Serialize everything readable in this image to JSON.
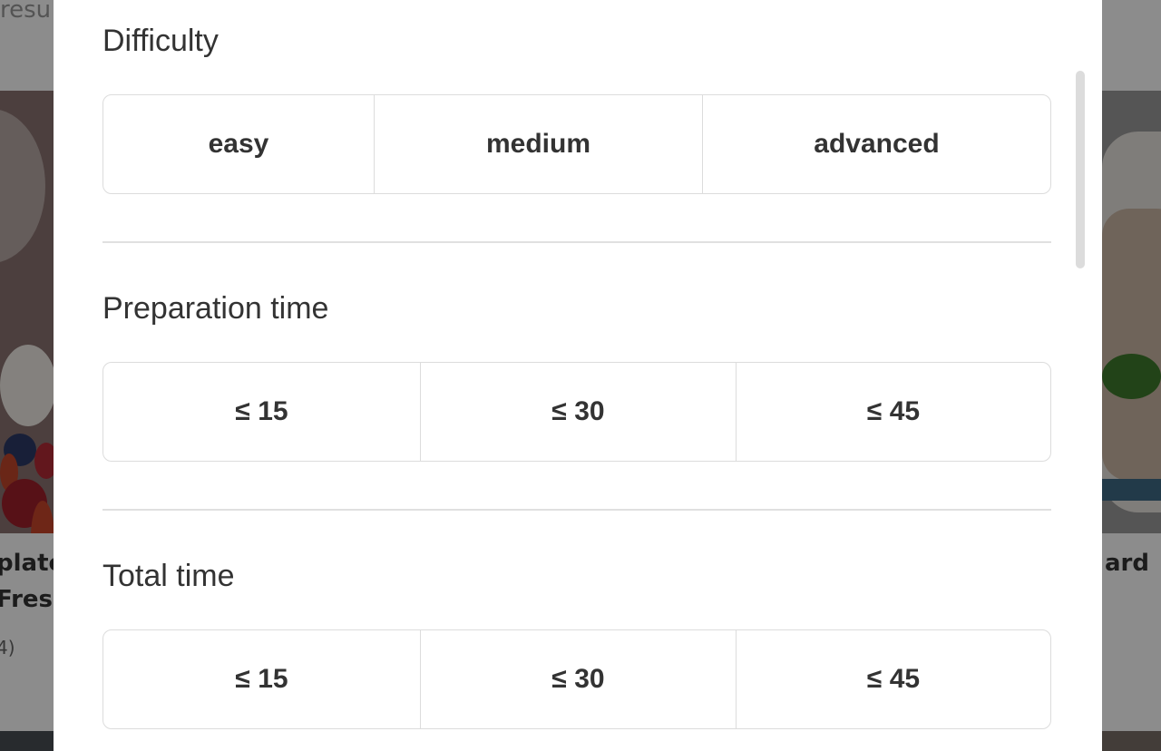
{
  "background": {
    "left_header_partial": "resu",
    "left_card": {
      "title_line1": "plate",
      "title_line2": "Fresh",
      "meta": "4)"
    },
    "right_card": {
      "title_line1": "ard"
    }
  },
  "filters": {
    "difficulty": {
      "title": "Difficulty",
      "options": [
        "easy",
        "medium",
        "advanced"
      ]
    },
    "preparation_time": {
      "title": "Preparation time",
      "options": [
        "≤ 15",
        "≤ 30",
        "≤ 45"
      ]
    },
    "total_time": {
      "title": "Total time",
      "options": [
        "≤ 15",
        "≤ 30",
        "≤ 45"
      ]
    }
  },
  "colors": {
    "text": "#333333",
    "border": "#dcdcdc",
    "overlay": "rgba(0,0,0,0.45)",
    "modal_bg": "#ffffff"
  }
}
